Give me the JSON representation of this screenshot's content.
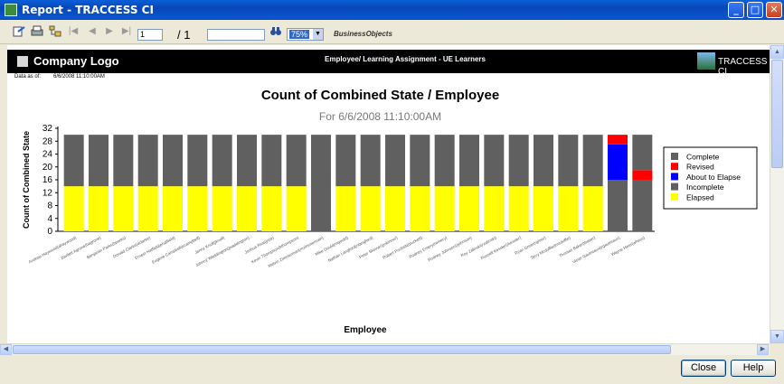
{
  "window": {
    "title": "Report - TRACCESS CI",
    "min": "_",
    "max": "□",
    "close": "✕"
  },
  "toolbar": {
    "page_current": "1",
    "page_total": "/ 1",
    "zoom": "75%",
    "brand": "BusinessObjects",
    "first": "|◀",
    "prev": "◀",
    "next": "▶",
    "last": "▶|"
  },
  "report": {
    "company_logo": "Company Logo",
    "subtitle": "Employee/ Learning Assignment - UE Learners",
    "brand_logo": "TRACCESS CI",
    "data_as_of_label": "Data as of:",
    "data_as_of_value": "6/6/2008   11:10:00AM"
  },
  "chart_data": {
    "type": "bar",
    "stacked": true,
    "title": "Count of Combined State / Employee",
    "subtitle": "For 6/6/2008  11:10:00AM",
    "xlabel": "Employee",
    "ylabel": "Count of Combined State",
    "ylim": [
      0,
      32
    ],
    "yticks": [
      0,
      4,
      8,
      12,
      16,
      20,
      24,
      28,
      32
    ],
    "legend_position": "right",
    "categories": [
      "Andrew Haywood(ahaywood)",
      "Bartlett Agrone(bagrone)",
      "Benjamin Parks(bparks)",
      "Donald Clarke(dclarke)",
      "Ernest Hatfield(ehatfield)",
      "Eugene Campbell(ecampbell)",
      "Jenny Knoll(jknoll)",
      "Johnny Waddington(jwaddington)",
      "Joshua Rice(jrice)",
      "Kevin Thompson(kthompson)",
      "Melvin Zimmerman(mzimmerman)",
      "Mike Gould(mgould)",
      "Nathan Langford(nlangford)",
      "Peter Skinner(pskinner)",
      "Robert Puckett(rpuckett)",
      "Rodney Emery(remery)",
      "Rodney Johnson(rjohnson)",
      "Roy Zalinski(rzalinski)",
      "Russell Kessler(rkessler)",
      "Ryan Greer(rgreer)",
      "Terry Mcduffie(tmcduffie)",
      "Thomas Baker(tbaker)",
      "Victor Gautreaux(vgautreaux)",
      "Wayne Hess(whess)"
    ],
    "series": [
      {
        "name": "Elapsed",
        "color": "#ffff00",
        "values": [
          14,
          14,
          14,
          14,
          14,
          14,
          14,
          14,
          14,
          14,
          0,
          14,
          14,
          14,
          14,
          14,
          14,
          14,
          14,
          14,
          14,
          14,
          0,
          0
        ]
      },
      {
        "name": "Incomplete",
        "color": "#606060",
        "values": [
          16,
          16,
          16,
          16,
          16,
          16,
          16,
          16,
          16,
          16,
          30,
          16,
          16,
          16,
          16,
          16,
          16,
          16,
          16,
          16,
          16,
          16,
          16,
          16
        ]
      },
      {
        "name": "About to Elapse",
        "color": "#0000ff",
        "values": [
          0,
          0,
          0,
          0,
          0,
          0,
          0,
          0,
          0,
          0,
          0,
          0,
          0,
          0,
          0,
          0,
          0,
          0,
          0,
          0,
          0,
          0,
          11,
          0
        ]
      },
      {
        "name": "Revised",
        "color": "#ff0000",
        "values": [
          0,
          0,
          0,
          0,
          0,
          0,
          0,
          0,
          0,
          0,
          0,
          0,
          0,
          0,
          0,
          0,
          0,
          0,
          0,
          0,
          0,
          0,
          3,
          3
        ]
      },
      {
        "name": "Complete",
        "color": "#606060",
        "values": [
          0,
          0,
          0,
          0,
          0,
          0,
          0,
          0,
          0,
          0,
          0,
          0,
          0,
          0,
          0,
          0,
          0,
          0,
          0,
          0,
          0,
          0,
          0,
          11
        ]
      }
    ],
    "legend_order": [
      "Complete",
      "Revised",
      "About to Elapse",
      "Incomplete",
      "Elapsed"
    ]
  },
  "buttons": {
    "close": "Close",
    "help": "Help"
  },
  "scroll": {
    "up": "▲",
    "down": "▼",
    "left": "◀",
    "right": "▶"
  }
}
